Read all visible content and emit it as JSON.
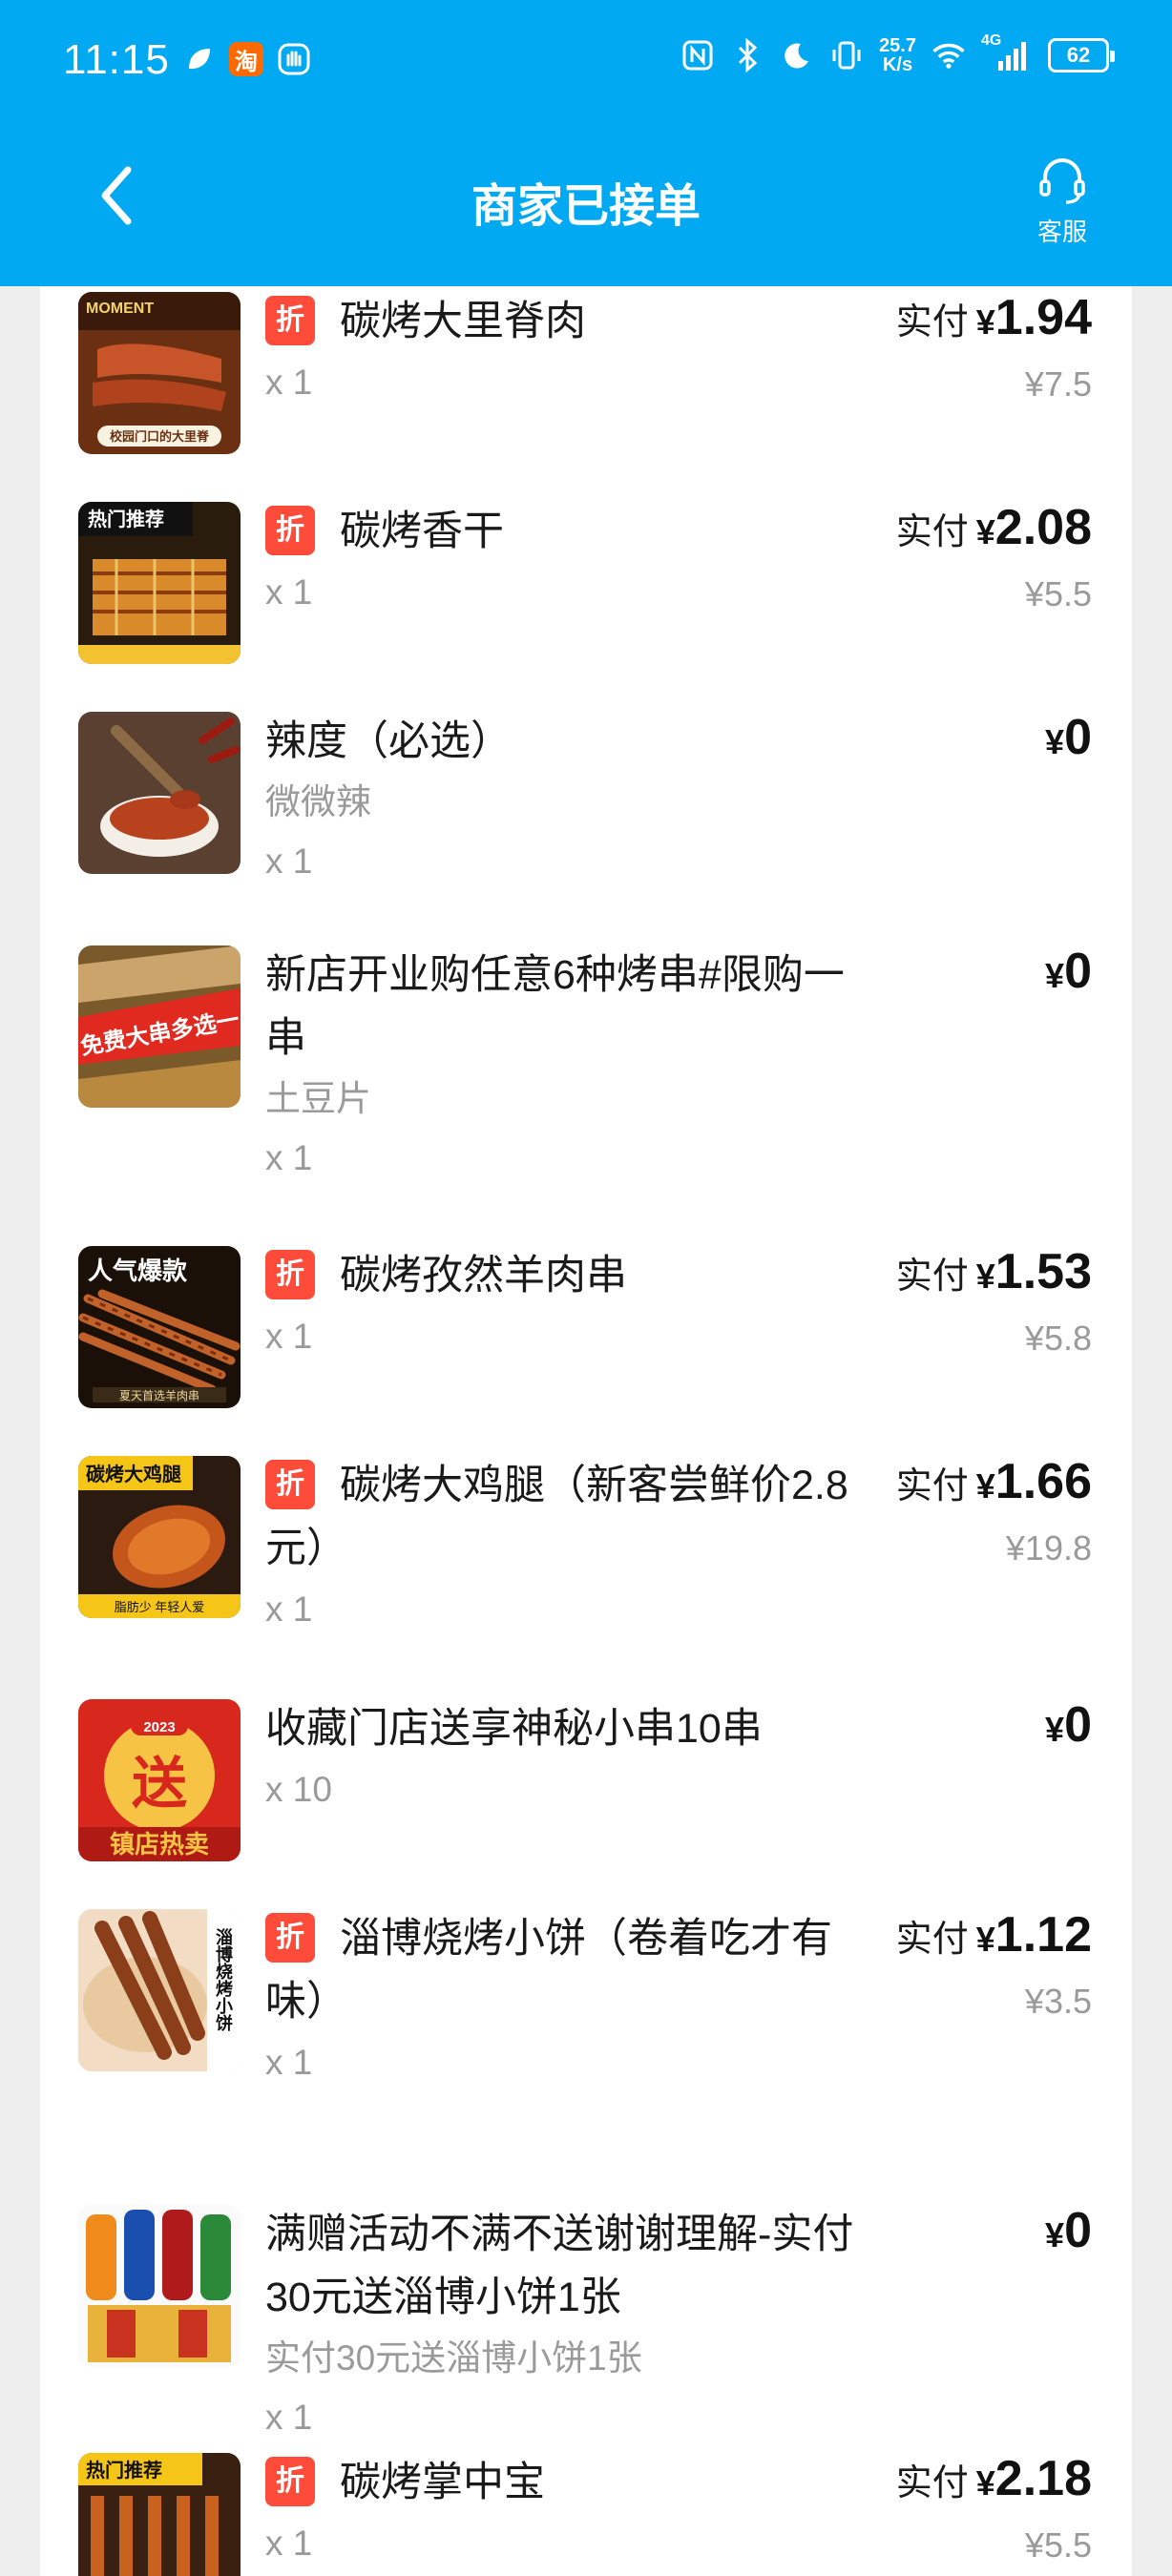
{
  "status_bar": {
    "time": "11:15",
    "taobao_badge": "淘",
    "net_speed_value": "25.7",
    "net_speed_unit": "K/s",
    "network_type": "4G",
    "battery": "62"
  },
  "header": {
    "title": "商家已接单",
    "customer_service_label": "客服",
    "background_color": "#01a9f3"
  },
  "colors": {
    "discount_badge": "#ff4b39",
    "muted_text": "#9a9a9a"
  },
  "labels": {
    "discount_badge": "折",
    "paid_prefix": "实付",
    "currency": "¥"
  },
  "items": [
    {
      "name": "碳烤大里脊肉",
      "qty": "x 1",
      "paid": "1.94",
      "original": "¥7.5"
    },
    {
      "name": "碳烤香干",
      "qty": "x 1",
      "paid": "2.08",
      "original": "¥5.5"
    },
    {
      "name": "辣度（必选）",
      "spec": "微微辣",
      "qty": "x 1",
      "price": "0"
    },
    {
      "name": "新店开业购任意6种烤串#限购一串",
      "spec": "土豆片",
      "qty": "x 1",
      "price": "0"
    },
    {
      "name": "碳烤孜然羊肉串",
      "qty": "x 1",
      "paid": "1.53",
      "original": "¥5.8"
    },
    {
      "name": "碳烤大鸡腿（新客尝鲜价2.8元）",
      "qty": "x 1",
      "paid": "1.66",
      "original": "¥19.8"
    },
    {
      "name": "收藏门店送享神秘小串10串",
      "qty": "x 10",
      "price": "0"
    },
    {
      "name": "淄博烧烤小饼（卷着吃才有味）",
      "qty": "x 1",
      "paid": "1.12",
      "original": "¥3.5"
    },
    {
      "name": "满赠活动不满不送谢谢理解-实付30元送淄博小饼1张",
      "spec": "实付30元送淄博小饼1张",
      "qty": "x 1",
      "price": "0"
    },
    {
      "name": "碳烤掌中宝",
      "qty": "x 1",
      "paid": "2.18",
      "original": "¥5.5"
    }
  ],
  "thumbnail_captions": {
    "item1_top": "MOMENT",
    "item1_bottom": "校园门口的大里脊",
    "item2_top": "热门推荐",
    "item3": "",
    "item4_banner": "免费大串多选一",
    "item5_top": "人气爆款",
    "item5_bottom": "夏天首选羊肉串",
    "item6_top": "碳烤大鸡腿",
    "item6_bottom": "脂肪少 年轻人爱",
    "item7_year": "2023",
    "item7_main": "送",
    "item7_bottom": "镇店热卖",
    "item8_side": "淄博烧烤小饼",
    "item10_top": "热门推荐"
  }
}
